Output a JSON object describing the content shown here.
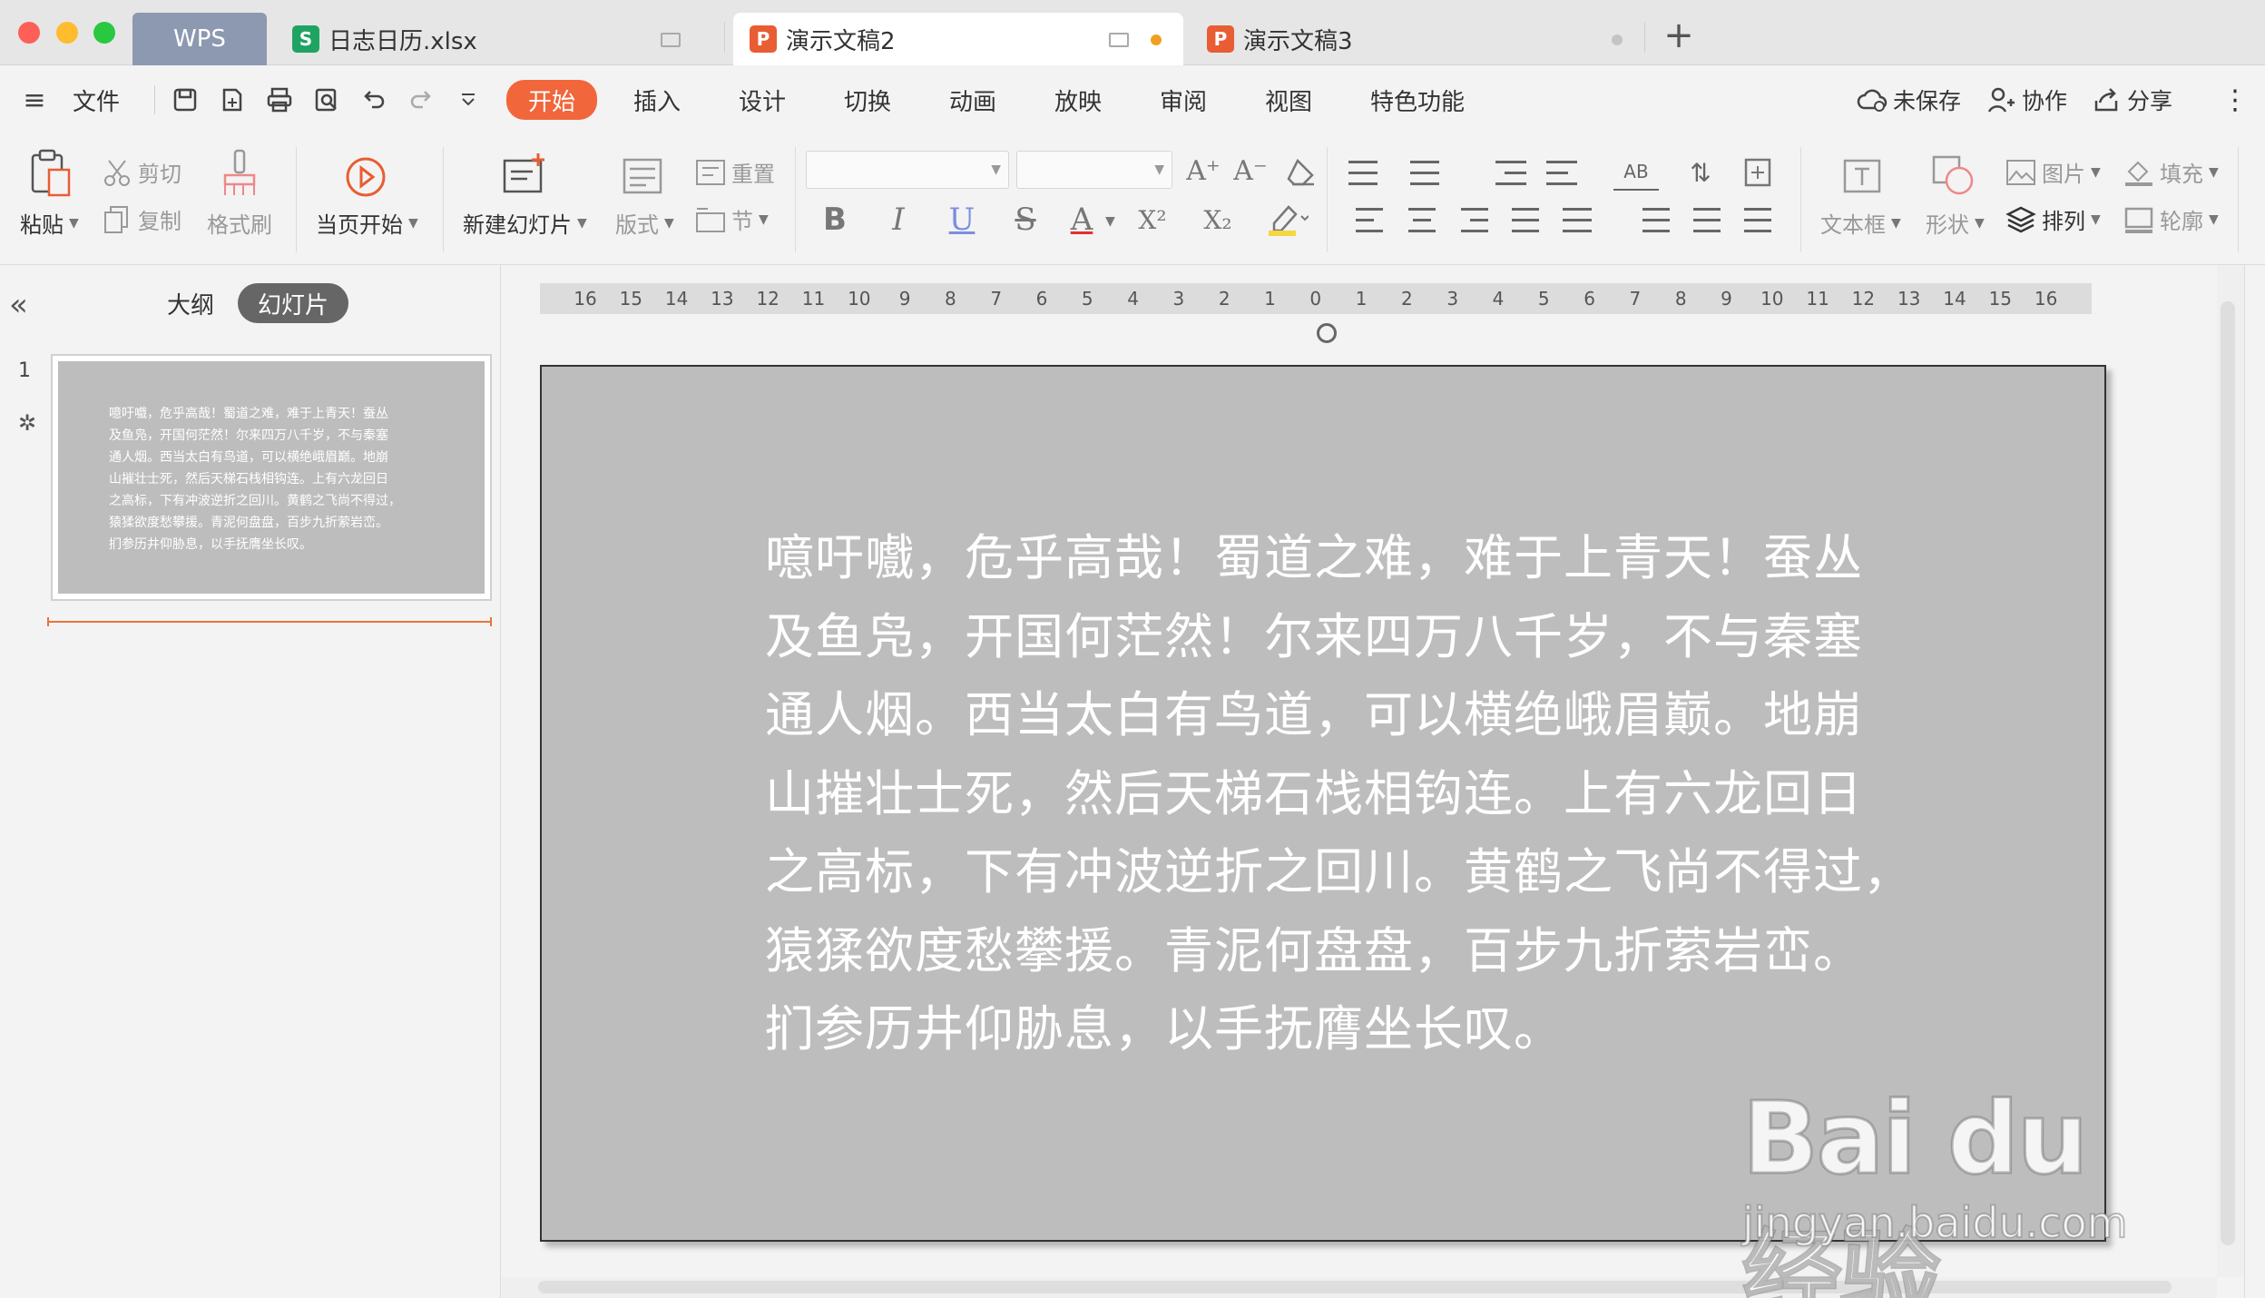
{
  "titlebar": {
    "tabs": [
      {
        "label": "WPS"
      },
      {
        "label": "日志日历.xlsx",
        "icon": "spreadsheet-icon",
        "icon_letter": "S"
      },
      {
        "label": "演示文稿2",
        "icon": "presentation-icon",
        "icon_letter": "P",
        "active": true
      },
      {
        "label": "演示文稿3",
        "icon": "presentation-icon",
        "icon_letter": "P"
      }
    ],
    "new_tab": "+"
  },
  "menubar": {
    "hamburger": "≡",
    "file": "文件",
    "items": [
      "开始",
      "插入",
      "设计",
      "切换",
      "动画",
      "放映",
      "审阅",
      "视图",
      "特色功能"
    ],
    "active": "开始",
    "right": {
      "unsaved": "未保存",
      "collaborate": "协作",
      "share": "分享",
      "more": "⋮"
    }
  },
  "ribbon": {
    "paste": "粘贴",
    "cut": "剪切",
    "copy": "复制",
    "format_painter": "格式刷",
    "from_current": "当页开始",
    "new_slide": "新建幻灯片",
    "layout": "版式",
    "reset": "重置",
    "section": "节",
    "format": {
      "bold": "B",
      "italic": "I",
      "underline": "U",
      "strike": "S",
      "font_color": "A",
      "superscript": "X²",
      "subscript": "X₂",
      "grow": "A⁺",
      "shrink": "A⁻"
    },
    "textbox": "文本框",
    "shape": "形状",
    "picture": "图片",
    "arrange": "排列",
    "fill": "填充",
    "outline": "轮廓"
  },
  "leftpanel": {
    "tabs": {
      "outline": "大纲",
      "slides": "幻灯片"
    },
    "slide_number": "1"
  },
  "ruler": [
    "16",
    "15",
    "14",
    "13",
    "12",
    "11",
    "10",
    "9",
    "8",
    "7",
    "6",
    "5",
    "4",
    "3",
    "2",
    "1",
    "0",
    "1",
    "2",
    "3",
    "4",
    "5",
    "6",
    "7",
    "8",
    "9",
    "10",
    "11",
    "12",
    "13",
    "14",
    "15",
    "16"
  ],
  "slide": {
    "lines": [
      "噫吁嚱，危乎高哉！蜀道之难，难于上青天！蚕丛",
      "及鱼凫，开国何茫然！尔来四万八千岁，不与秦塞",
      "通人烟。西当太白有鸟道，可以横绝峨眉巅。地崩",
      "山摧壮士死，然后天梯石栈相钩连。上有六龙回日",
      "之高标，下有冲波逆折之回川。黄鹤之飞尚不得过，",
      "猿猱欲度愁攀援。青泥何盘盘，百步九折萦岩峦。",
      "扪参历井仰胁息，以手抚膺坐长叹。"
    ]
  },
  "watermark": {
    "main": "Bai du 经验",
    "sub": "jingyan.baidu.com"
  },
  "colors": {
    "accent": "#f2663c",
    "slide_bg": "#bdbdbd",
    "xlsx_icon": "#1fa362",
    "ppt_icon": "#e85d33"
  }
}
